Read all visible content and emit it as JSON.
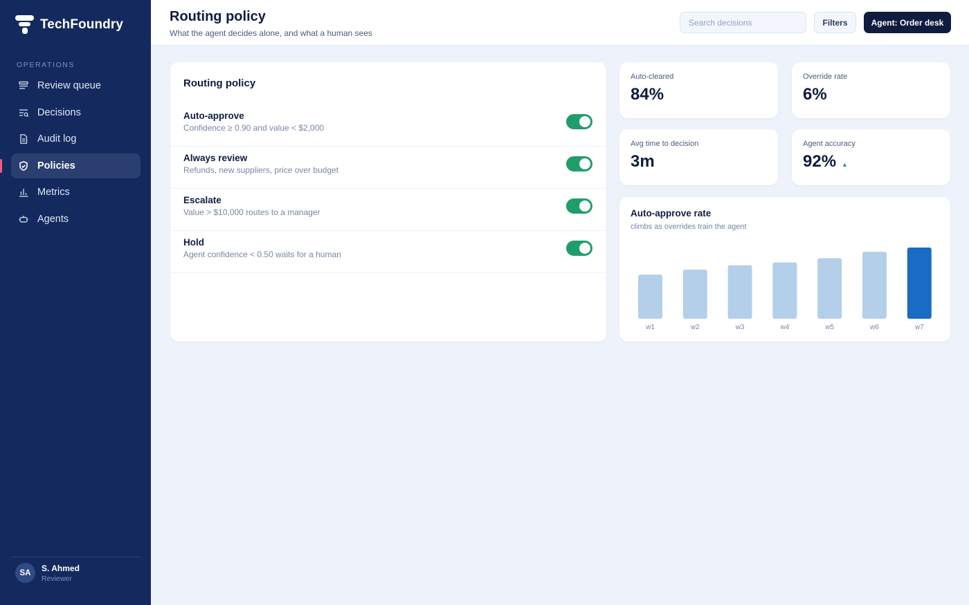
{
  "brand": {
    "name": "TechFoundry"
  },
  "sidebar": {
    "section": "OPERATIONS",
    "items": [
      {
        "label": "Review queue",
        "icon": "queue-icon",
        "active": false
      },
      {
        "label": "Decisions",
        "icon": "decisions-icon",
        "active": false
      },
      {
        "label": "Audit log",
        "icon": "document-icon",
        "active": false
      },
      {
        "label": "Policies",
        "icon": "shield-icon",
        "active": true
      },
      {
        "label": "Metrics",
        "icon": "bar-chart-icon",
        "active": false
      },
      {
        "label": "Agents",
        "icon": "agent-icon",
        "active": false
      }
    ],
    "user": {
      "initials": "SA",
      "name": "S. Ahmed",
      "role": "Reviewer"
    }
  },
  "header": {
    "title": "Routing policy",
    "subtitle": "What the agent decides alone, and what a human sees",
    "search_placeholder": "Search decisions",
    "filters_label": "Filters",
    "agent_label": "Agent: Order desk"
  },
  "policy": {
    "title": "Routing policy",
    "rules": [
      {
        "name": "Auto-approve",
        "description": "Confidence ≥ 0.90 and value < $2,000",
        "enabled": true
      },
      {
        "name": "Always review",
        "description": "Refunds, new suppliers, price over budget",
        "enabled": true
      },
      {
        "name": "Escalate",
        "description": "Value > $10,000 routes to a manager",
        "enabled": true
      },
      {
        "name": "Hold",
        "description": "Agent confidence < 0.50 waits for a human",
        "enabled": true
      }
    ]
  },
  "kpis": [
    {
      "label": "Auto-cleared",
      "value": "84%",
      "trend": ""
    },
    {
      "label": "Override rate",
      "value": "6%",
      "trend": ""
    },
    {
      "label": "Avg time to decision",
      "value": "3m",
      "trend": ""
    },
    {
      "label": "Agent accuracy",
      "value": "92%",
      "trend": "▲"
    }
  ],
  "colors": {
    "sidebar": "#142a5e",
    "accent": "#1f9d6b",
    "bar_light": "#b3cfea",
    "bar_highlight": "#1a6bc4",
    "active_marker": "#f25c7a"
  },
  "chart_data": {
    "type": "bar",
    "title": "Auto-approve rate",
    "subtitle": "climbs as overrides train the agent",
    "categories": [
      "w1",
      "w2",
      "w3",
      "w4",
      "w5",
      "w6",
      "w7"
    ],
    "values": [
      62,
      69,
      75,
      79,
      85,
      94,
      100
    ],
    "highlight_index": 6,
    "ylim": [
      0,
      100
    ],
    "grid": false,
    "legend": "none"
  }
}
